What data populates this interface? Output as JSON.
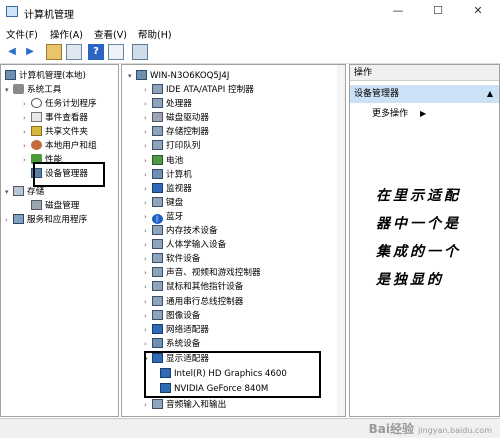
{
  "window": {
    "title": "计算机管理",
    "min": "—",
    "max": "☐",
    "close": "✕"
  },
  "menu": [
    "文件(F)",
    "操作(A)",
    "查看(V)",
    "帮助(H)"
  ],
  "left_tree": {
    "root": "计算机管理(本地)",
    "system_tools": "系统工具",
    "items": [
      "任务计划程序",
      "事件查看器",
      "共享文件夹",
      "本地用户和组",
      "性能",
      "设备管理器"
    ],
    "storage": "存储",
    "disk_mgmt": "磁盘管理",
    "services": "服务和应用程序"
  },
  "device_tree": {
    "root": "WIN-N3O6KOQ5J4J",
    "categories": [
      "IDE ATA/ATAPI 控制器",
      "处理器",
      "磁盘驱动器",
      "存储控制器",
      "打印队列",
      "电池",
      "计算机",
      "监视器",
      "键盘",
      "蓝牙",
      "内存技术设备",
      "人体学输入设备",
      "软件设备",
      "声音、视频和游戏控制器",
      "鼠标和其他指针设备",
      "通用串行总线控制器",
      "图像设备",
      "网络适配器",
      "系统设备"
    ],
    "display_adapters": {
      "label": "显示适配器",
      "children": [
        "Intel(R) HD Graphics 4600",
        "NVIDIA GeForce 840M"
      ]
    },
    "last": "音频输入和输出"
  },
  "actions": {
    "header": "操作",
    "selected": "设备管理器",
    "more": "更多操作"
  },
  "annotation": [
    "在里示适配",
    "器中一个是",
    "集成的一个",
    "是独显的"
  ],
  "watermark": {
    "main": "Bai经验",
    "sub": "jingyan.baidu.com"
  }
}
